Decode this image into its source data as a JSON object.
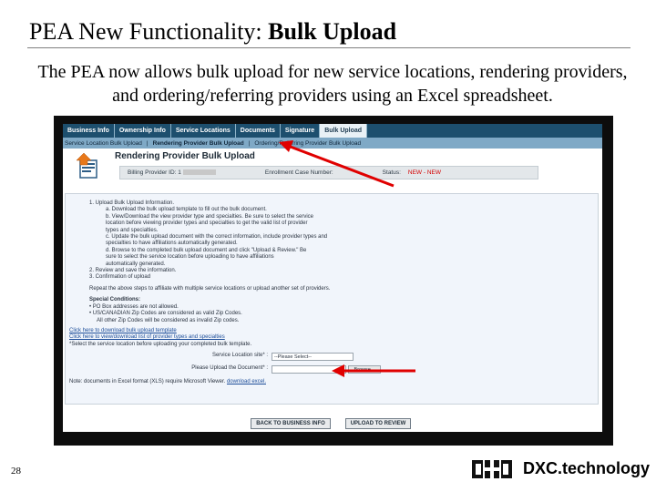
{
  "slide": {
    "title_normal": "PEA New Functionality: ",
    "title_bold": "Bulk Upload",
    "subtitle": "The PEA now allows bulk upload for new service locations, rendering providers, and ordering/referring providers using an Excel spreadsheet.",
    "slide_number": "28",
    "logo_text": "DXC.technology"
  },
  "app": {
    "tabs": [
      {
        "label": "Business Info"
      },
      {
        "label": "Ownership Info"
      },
      {
        "label": "Service Locations"
      },
      {
        "label": "Documents"
      },
      {
        "label": "Signature"
      },
      {
        "label": "Bulk Upload"
      }
    ],
    "subnav": [
      {
        "label": "Service Location Bulk Upload"
      },
      {
        "label": "Rendering Provider Bulk Upload"
      },
      {
        "label": "Ordering/Referring Provider Bulk Upload"
      }
    ],
    "subnav_separator": "|",
    "page_header": "Rendering Provider Bulk Upload",
    "info": {
      "billing_label": "Billing Provider ID: 1",
      "case_label": "Enrollment Case Number:",
      "status_label": "Status:",
      "status_value": "NEW - NEW"
    },
    "instructions": {
      "heading": "1.   Upload Bulk Upload Information.",
      "lines": [
        "a.   Download the bulk upload template to fill out the bulk document.",
        "b.   View/Download the view provider type and specialties. Be sure to select the service",
        "      location before viewing provider types and specialties to get the valid list of provider",
        "      types and specialties.",
        "c.   Update the bulk upload document with the correct information, include provider types and",
        "      specialties to have affiliations automatically generated.",
        "d.   Browse to the completed bulk upload document and click \"Upload & Review.\" Be",
        "      sure to select the service location before uploading to have affiliations",
        "      automatically generated."
      ],
      "step2": "2.   Review and save the information.",
      "step3": "3.   Confirmation of upload",
      "repeat": "Repeat the above steps to affiliate with multiple service locations or upload another set of providers."
    },
    "special": {
      "heading": "Special Conditions:",
      "items": [
        "PO Box addresses are not allowed.",
        "US/CANADIAN Zip Codes are considered as valid Zip Codes.",
        "All other Zip Codes will be considered as invalid Zip codes."
      ]
    },
    "links": {
      "template": "Click here to download bulk upload template",
      "types": "Click here to view/download list of provider types and specialties"
    },
    "form": {
      "instruction": "*Select the service location before uploading your completed bulk template.",
      "location_label": "Service Location site* :",
      "location_value": "--Please Select--",
      "document_label": "Please Upload the Document* :",
      "browse_label": "Browse..."
    },
    "note": {
      "text": "Note: documents in Excel format (XLS) require Microsoft Viewer. ",
      "link": "download excel."
    },
    "buttons": {
      "back": "BACK TO BUSINESS INFO",
      "upload": "UPLOAD TO REVIEW"
    }
  },
  "colors": {
    "tab_bar": "#1d4f6e",
    "subnav": "#7fa9c6",
    "arrow": "#e00000",
    "status": "#d40000"
  }
}
